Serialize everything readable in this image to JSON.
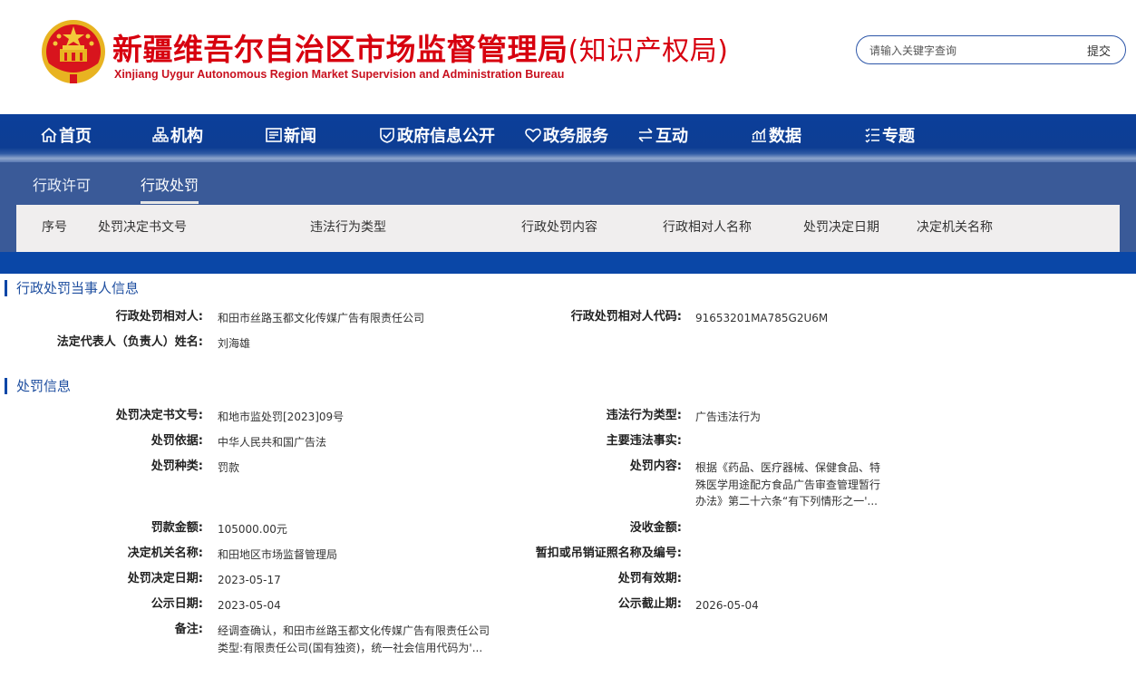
{
  "header": {
    "title": "新疆维吾尔自治区市场监督管理局",
    "title_sub": "(知识产权局)",
    "title_en": "Xinjiang Uygur Autonomous Region Market Supervision and Administration Bureau",
    "emblem_icon": "national-emblem-icon"
  },
  "search": {
    "placeholder": "请输入关键字查询",
    "submit_label": "提交"
  },
  "nav": {
    "items": [
      {
        "label": "首页",
        "icon": "home-icon"
      },
      {
        "label": "机构",
        "icon": "org-chart-icon"
      },
      {
        "label": "新闻",
        "icon": "news-icon"
      },
      {
        "label": "政府信息公开",
        "icon": "shield-check-icon"
      },
      {
        "label": "政务服务",
        "icon": "heart-icon"
      },
      {
        "label": "互动",
        "icon": "exchange-arrows-icon"
      },
      {
        "label": "数据",
        "icon": "trend-chart-icon"
      },
      {
        "label": "专题",
        "icon": "list-icon"
      }
    ]
  },
  "tabs": [
    {
      "label": "行政许可",
      "active": false
    },
    {
      "label": "行政处罚",
      "active": true
    }
  ],
  "table": {
    "columns": [
      "序号",
      "处罚决定书文号",
      "违法行为类型",
      "行政处罚内容",
      "行政相对人名称",
      "处罚决定日期",
      "决定机关名称"
    ]
  },
  "party_section": {
    "heading": "行政处罚当事人信息",
    "party_name_label": "行政处罚相对人:",
    "party_name": "和田市丝路玉都文化传媒广告有限责任公司",
    "party_code_label": "行政处罚相对人代码:",
    "party_code": "91653201MA785G2U6M",
    "legal_rep_label": "法定代表人（负责人）姓名:",
    "legal_rep": "刘海雄"
  },
  "penalty_section": {
    "heading": "处罚信息",
    "doc_no_label": "处罚决定书文号:",
    "doc_no": "和地市监处罚[2023]09号",
    "violation_type_label": "违法行为类型:",
    "violation_type": "广告违法行为",
    "basis_label": "处罚依据:",
    "basis": "中华人民共和国广告法",
    "main_facts_label": "主要违法事实:",
    "main_facts": "",
    "category_label": "处罚种类:",
    "category": "罚款",
    "content_label": "处罚内容:",
    "content": "根据《药品、医疗器械、保健食品、特殊医学用途配方食品广告审查管理暂行办法》第二十六条“有下列情形之一'...",
    "fine_label": "罚款金额:",
    "fine": "105000.00元",
    "confiscation_label": "没收金额:",
    "confiscation": "",
    "authority_label": "决定机关名称:",
    "authority": "和田地区市场监督管理局",
    "license_label": "暂扣或吊销证照名称及编号:",
    "license": "",
    "decision_date_label": "处罚决定日期:",
    "decision_date": "2023-05-17",
    "validity_label": "处罚有效期:",
    "validity": "",
    "publish_date_label": "公示日期:",
    "publish_date": "2023-05-04",
    "publish_end_label": "公示截止期:",
    "publish_end": "2026-05-04",
    "remark_label": "备注:",
    "remark": "经调查确认，和田市丝路玉都文化传媒广告有限责任公司类型:有限责任公司(国有独资)，统一社会信用代码为'..."
  },
  "colors": {
    "nav_blue": "#0c3f9a",
    "tab_blue": "#3a5a98",
    "title_red": "#d7000f",
    "section_blue": "#1f4fa0"
  }
}
